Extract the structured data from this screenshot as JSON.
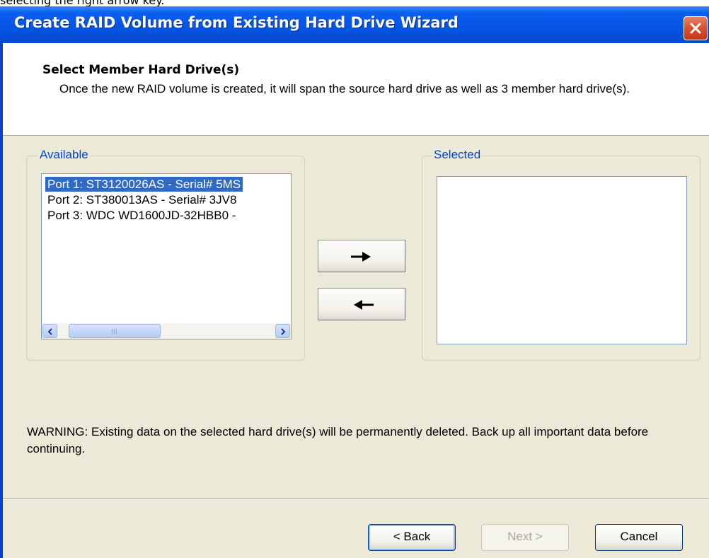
{
  "caption": "selecting the right arrow key.",
  "window": {
    "title": "Create RAID Volume from Existing Hard Drive Wizard"
  },
  "header": {
    "title": "Select Member Hard Drive(s)",
    "description": "Once the new RAID volume is created, it will span the source hard drive as well as 3 member hard drive(s)."
  },
  "available": {
    "label": "Available",
    "items": [
      "Port 1: ST3120026AS - Serial# 5MS",
      "Port 2: ST380013AS - Serial# 3JV8",
      "Port 3: WDC WD1600JD-32HBB0 -"
    ],
    "selected_index": 0
  },
  "selected": {
    "label": "Selected",
    "items": []
  },
  "warning": "WARNING: Existing data on the selected hard drive(s) will be permanently deleted. Back up all important data before continuing.",
  "buttons": {
    "back": "< Back",
    "next": "Next >",
    "cancel": "Cancel"
  },
  "icons": {
    "add": "right-arrow-icon",
    "remove": "left-arrow-icon",
    "close": "close-icon"
  },
  "colors": {
    "titlebar": "#0554e3",
    "selection": "#316ac5",
    "group_label": "#0046d5",
    "dialog_bg": "#ece9d8"
  }
}
